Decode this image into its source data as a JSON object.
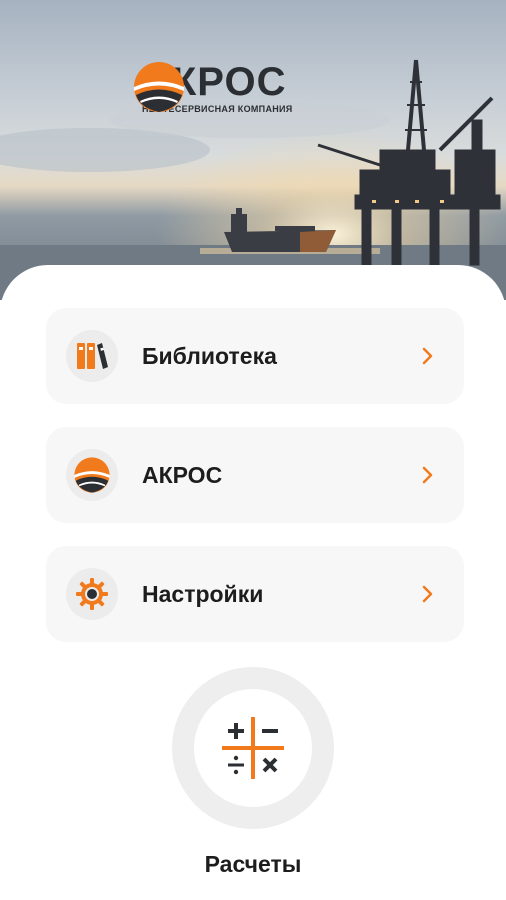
{
  "brand": {
    "name": "АКРОС",
    "tagline": "НЕФТЕСЕРВИСНАЯ КОМПАНИЯ"
  },
  "menu": [
    {
      "label": "Библиотека",
      "icon": "library-books-icon"
    },
    {
      "label": "АКРОС",
      "icon": "akros-logo-icon"
    },
    {
      "label": "Настройки",
      "icon": "gear-icon"
    }
  ],
  "calculations": {
    "label": "Расчеты",
    "icon": "calculator-icon"
  },
  "colors": {
    "accent": "#f07a1c",
    "dark": "#2b2f33",
    "card_bg": "#f7f7f7"
  }
}
